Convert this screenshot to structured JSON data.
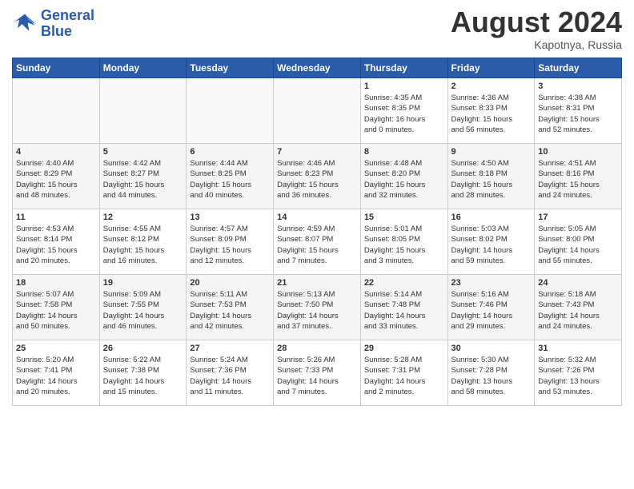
{
  "logo": {
    "line1": "General",
    "line2": "Blue"
  },
  "title": "August 2024",
  "location": "Kapotnya, Russia",
  "days_header": [
    "Sunday",
    "Monday",
    "Tuesday",
    "Wednesday",
    "Thursday",
    "Friday",
    "Saturday"
  ],
  "weeks": [
    [
      {
        "day": "",
        "info": ""
      },
      {
        "day": "",
        "info": ""
      },
      {
        "day": "",
        "info": ""
      },
      {
        "day": "",
        "info": ""
      },
      {
        "day": "1",
        "info": "Sunrise: 4:35 AM\nSunset: 8:35 PM\nDaylight: 16 hours\nand 0 minutes."
      },
      {
        "day": "2",
        "info": "Sunrise: 4:36 AM\nSunset: 8:33 PM\nDaylight: 15 hours\nand 56 minutes."
      },
      {
        "day": "3",
        "info": "Sunrise: 4:38 AM\nSunset: 8:31 PM\nDaylight: 15 hours\nand 52 minutes."
      }
    ],
    [
      {
        "day": "4",
        "info": "Sunrise: 4:40 AM\nSunset: 8:29 PM\nDaylight: 15 hours\nand 48 minutes."
      },
      {
        "day": "5",
        "info": "Sunrise: 4:42 AM\nSunset: 8:27 PM\nDaylight: 15 hours\nand 44 minutes."
      },
      {
        "day": "6",
        "info": "Sunrise: 4:44 AM\nSunset: 8:25 PM\nDaylight: 15 hours\nand 40 minutes."
      },
      {
        "day": "7",
        "info": "Sunrise: 4:46 AM\nSunset: 8:23 PM\nDaylight: 15 hours\nand 36 minutes."
      },
      {
        "day": "8",
        "info": "Sunrise: 4:48 AM\nSunset: 8:20 PM\nDaylight: 15 hours\nand 32 minutes."
      },
      {
        "day": "9",
        "info": "Sunrise: 4:50 AM\nSunset: 8:18 PM\nDaylight: 15 hours\nand 28 minutes."
      },
      {
        "day": "10",
        "info": "Sunrise: 4:51 AM\nSunset: 8:16 PM\nDaylight: 15 hours\nand 24 minutes."
      }
    ],
    [
      {
        "day": "11",
        "info": "Sunrise: 4:53 AM\nSunset: 8:14 PM\nDaylight: 15 hours\nand 20 minutes."
      },
      {
        "day": "12",
        "info": "Sunrise: 4:55 AM\nSunset: 8:12 PM\nDaylight: 15 hours\nand 16 minutes."
      },
      {
        "day": "13",
        "info": "Sunrise: 4:57 AM\nSunset: 8:09 PM\nDaylight: 15 hours\nand 12 minutes."
      },
      {
        "day": "14",
        "info": "Sunrise: 4:59 AM\nSunset: 8:07 PM\nDaylight: 15 hours\nand 7 minutes."
      },
      {
        "day": "15",
        "info": "Sunrise: 5:01 AM\nSunset: 8:05 PM\nDaylight: 15 hours\nand 3 minutes."
      },
      {
        "day": "16",
        "info": "Sunrise: 5:03 AM\nSunset: 8:02 PM\nDaylight: 14 hours\nand 59 minutes."
      },
      {
        "day": "17",
        "info": "Sunrise: 5:05 AM\nSunset: 8:00 PM\nDaylight: 14 hours\nand 55 minutes."
      }
    ],
    [
      {
        "day": "18",
        "info": "Sunrise: 5:07 AM\nSunset: 7:58 PM\nDaylight: 14 hours\nand 50 minutes."
      },
      {
        "day": "19",
        "info": "Sunrise: 5:09 AM\nSunset: 7:55 PM\nDaylight: 14 hours\nand 46 minutes."
      },
      {
        "day": "20",
        "info": "Sunrise: 5:11 AM\nSunset: 7:53 PM\nDaylight: 14 hours\nand 42 minutes."
      },
      {
        "day": "21",
        "info": "Sunrise: 5:13 AM\nSunset: 7:50 PM\nDaylight: 14 hours\nand 37 minutes."
      },
      {
        "day": "22",
        "info": "Sunrise: 5:14 AM\nSunset: 7:48 PM\nDaylight: 14 hours\nand 33 minutes."
      },
      {
        "day": "23",
        "info": "Sunrise: 5:16 AM\nSunset: 7:46 PM\nDaylight: 14 hours\nand 29 minutes."
      },
      {
        "day": "24",
        "info": "Sunrise: 5:18 AM\nSunset: 7:43 PM\nDaylight: 14 hours\nand 24 minutes."
      }
    ],
    [
      {
        "day": "25",
        "info": "Sunrise: 5:20 AM\nSunset: 7:41 PM\nDaylight: 14 hours\nand 20 minutes."
      },
      {
        "day": "26",
        "info": "Sunrise: 5:22 AM\nSunset: 7:38 PM\nDaylight: 14 hours\nand 15 minutes."
      },
      {
        "day": "27",
        "info": "Sunrise: 5:24 AM\nSunset: 7:36 PM\nDaylight: 14 hours\nand 11 minutes."
      },
      {
        "day": "28",
        "info": "Sunrise: 5:26 AM\nSunset: 7:33 PM\nDaylight: 14 hours\nand 7 minutes."
      },
      {
        "day": "29",
        "info": "Sunrise: 5:28 AM\nSunset: 7:31 PM\nDaylight: 14 hours\nand 2 minutes."
      },
      {
        "day": "30",
        "info": "Sunrise: 5:30 AM\nSunset: 7:28 PM\nDaylight: 13 hours\nand 58 minutes."
      },
      {
        "day": "31",
        "info": "Sunrise: 5:32 AM\nSunset: 7:26 PM\nDaylight: 13 hours\nand 53 minutes."
      }
    ]
  ]
}
